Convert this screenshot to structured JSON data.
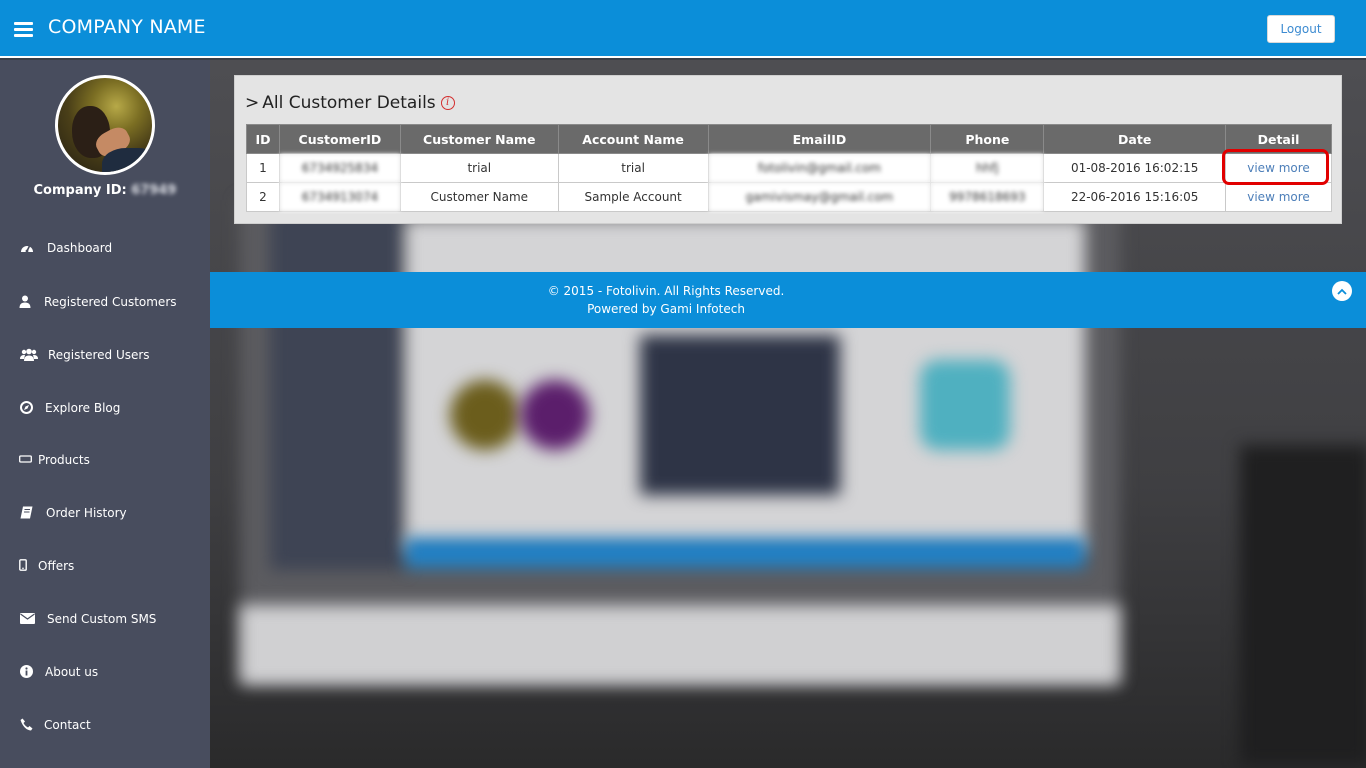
{
  "header": {
    "brand": "COMPANY NAME",
    "logout_label": "Logout"
  },
  "sidebar": {
    "company_id_label": "Company ID:",
    "company_id_value": "67949",
    "items": [
      {
        "label": "Dashboard",
        "icon": "dashboard-icon"
      },
      {
        "label": "Registered Customers",
        "icon": "user-icon"
      },
      {
        "label": "Registered Users",
        "icon": "users-icon"
      },
      {
        "label": "Explore Blog",
        "icon": "compass-icon"
      },
      {
        "label": "Products",
        "icon": "rectangle-icon"
      },
      {
        "label": "Order History",
        "icon": "book-icon"
      },
      {
        "label": "Offers",
        "icon": "mobile-icon"
      },
      {
        "label": "Send Custom SMS",
        "icon": "envelope-icon"
      },
      {
        "label": "About us",
        "icon": "info-circle-icon"
      },
      {
        "label": "Contact",
        "icon": "phone-icon"
      }
    ]
  },
  "panel": {
    "title": "All Customer Details",
    "chevron": ">",
    "info_glyph": "i",
    "columns": [
      "ID",
      "CustomerID",
      "Customer Name",
      "Account Name",
      "EmailID",
      "Phone",
      "Date",
      "Detail"
    ],
    "rows": [
      {
        "id": "1",
        "customer_id": "6734925834",
        "customer_name": "trial",
        "account_name": "trial",
        "email": "fotolivin@gmail.com",
        "phone": "hhfj",
        "date": "01-08-2016 16:02:15",
        "detail": "view more"
      },
      {
        "id": "2",
        "customer_id": "6734913074",
        "customer_name": "Customer Name",
        "account_name": "Sample Account",
        "email": "gamivismay@gmail.com",
        "phone": "9978618693",
        "date": "22-06-2016 15:16:05",
        "detail": "view more"
      }
    ]
  },
  "footer": {
    "copyright": "© 2015 - Fotolivin. All Rights Reserved.",
    "powered": "Powered by Gami Infotech"
  },
  "colors": {
    "header_bg": "#0b8ed9",
    "sidebar_bg": "#484d5e",
    "table_header": "#6a6a6a",
    "link": "#4d7fb9",
    "highlight": "#e10000"
  }
}
